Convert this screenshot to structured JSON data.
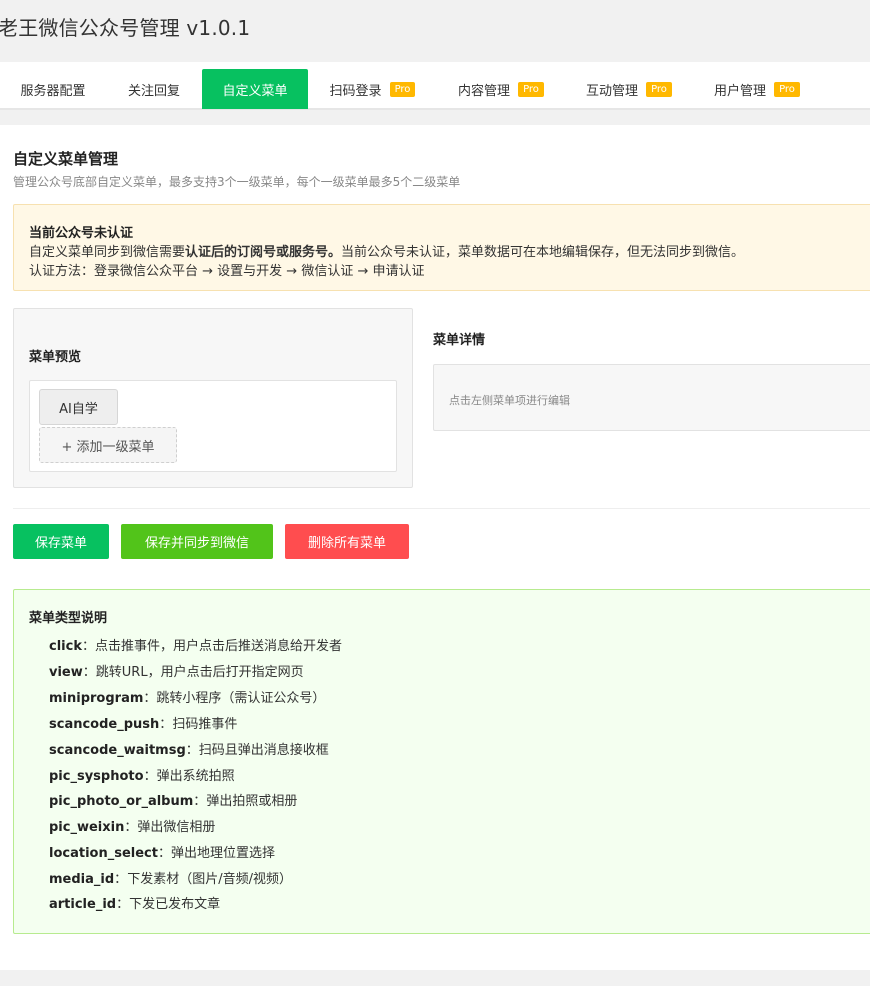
{
  "app": {
    "title": "老王微信公众号管理 v1.0.1"
  },
  "tabs": [
    {
      "label": "服务器配置",
      "pro": ""
    },
    {
      "label": "关注回复",
      "pro": ""
    },
    {
      "label": "自定义菜单",
      "pro": ""
    },
    {
      "label": "扫码登录",
      "pro": "Pro"
    },
    {
      "label": "内容管理",
      "pro": "Pro"
    },
    {
      "label": "互动管理",
      "pro": "Pro"
    },
    {
      "label": "用户管理",
      "pro": "Pro"
    }
  ],
  "active_tab": "自定义菜单",
  "section": {
    "title": "自定义菜单管理",
    "desc": "管理公众号底部自定义菜单，最多支持3个一级菜单，每个一级菜单最多5个二级菜单"
  },
  "warning": {
    "title": "当前公众号未认证",
    "line2_prefix": "自定义菜单同步到微信需要",
    "line2_bold": "认证后的订阅号或服务号。",
    "line2_suffix": "当前公众号未认证，菜单数据可在本地编辑保存，但无法同步到微信。",
    "line3": "认证方法：登录微信公众平台 → 设置与开发 → 微信认证 → 申请认证"
  },
  "preview": {
    "title": "菜单预览",
    "menu_items": [
      "AI自学"
    ],
    "add_label": "+ 添加一级菜单"
  },
  "detail": {
    "title": "菜单详情",
    "hint": "点击左侧菜单项进行编辑"
  },
  "actions": {
    "save": "保存菜单",
    "save_sync": "保存并同步到微信",
    "delete_all": "删除所有菜单"
  },
  "types": {
    "title": "菜单类型说明",
    "items": [
      {
        "key": "click",
        "desc": "点击推事件，用户点击后推送消息给开发者"
      },
      {
        "key": "view",
        "desc": "跳转URL，用户点击后打开指定网页"
      },
      {
        "key": "miniprogram",
        "desc": "跳转小程序（需认证公众号）"
      },
      {
        "key": "scancode_push",
        "desc": "扫码推事件"
      },
      {
        "key": "scancode_waitmsg",
        "desc": "扫码且弹出消息接收框"
      },
      {
        "key": "pic_sysphoto",
        "desc": "弹出系统拍照"
      },
      {
        "key": "pic_photo_or_album",
        "desc": "弹出拍照或相册"
      },
      {
        "key": "pic_weixin",
        "desc": "弹出微信相册"
      },
      {
        "key": "location_select",
        "desc": "弹出地理位置选择"
      },
      {
        "key": "media_id",
        "desc": "下发素材（图片/音频/视频）"
      },
      {
        "key": "article_id",
        "desc": "下发已发布文章"
      }
    ],
    "separator": "："
  },
  "colors": {
    "primary": "#07c160",
    "sync": "#52c41a",
    "danger": "#ff4d4f",
    "pro_badge": "#ffb800",
    "warn_bg": "#fff8e6",
    "types_bg": "#f4fff0"
  }
}
